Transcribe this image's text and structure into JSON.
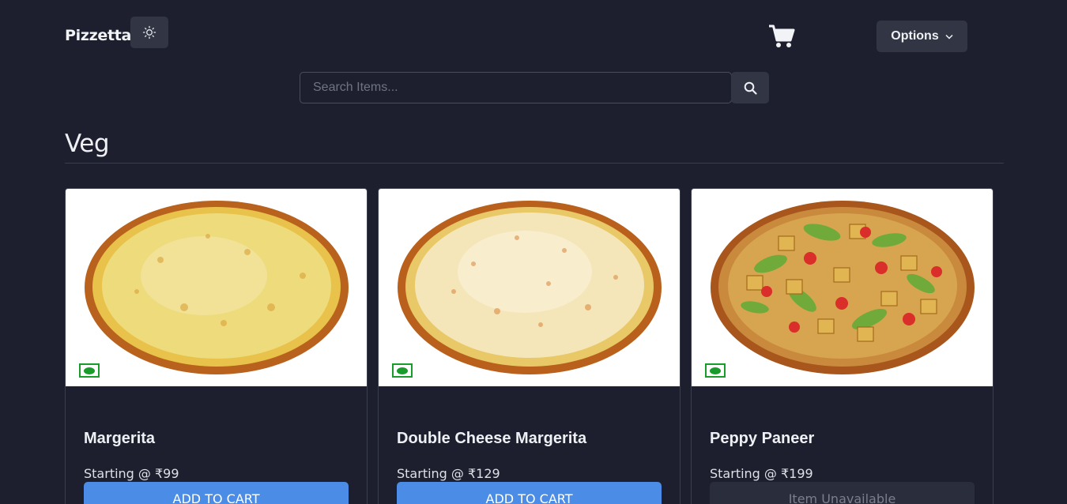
{
  "header": {
    "brand": "Pizzetta",
    "theme_toggle_icon": "sun-icon",
    "cart_icon": "shopping-cart-icon",
    "options_label": "Options"
  },
  "search": {
    "placeholder": "Search Items...",
    "value": "",
    "button_icon": "search-icon"
  },
  "section": {
    "title": "Veg"
  },
  "items": [
    {
      "name": "Margerita",
      "price": "Starting @ ₹99",
      "button": "ADD TO CART",
      "available": true,
      "veg": true
    },
    {
      "name": "Double Cheese Margerita",
      "price": "Starting @ ₹129",
      "button": "ADD TO CART",
      "available": true,
      "veg": true
    },
    {
      "name": "Peppy Paneer",
      "price": "Starting @ ₹199",
      "button": "Item Unavailable",
      "available": false,
      "veg": true
    }
  ],
  "colors": {
    "background": "#1d1f2e",
    "button_dark": "#323544",
    "primary": "#4a8ce6",
    "veg_green": "#1a9c2c"
  }
}
